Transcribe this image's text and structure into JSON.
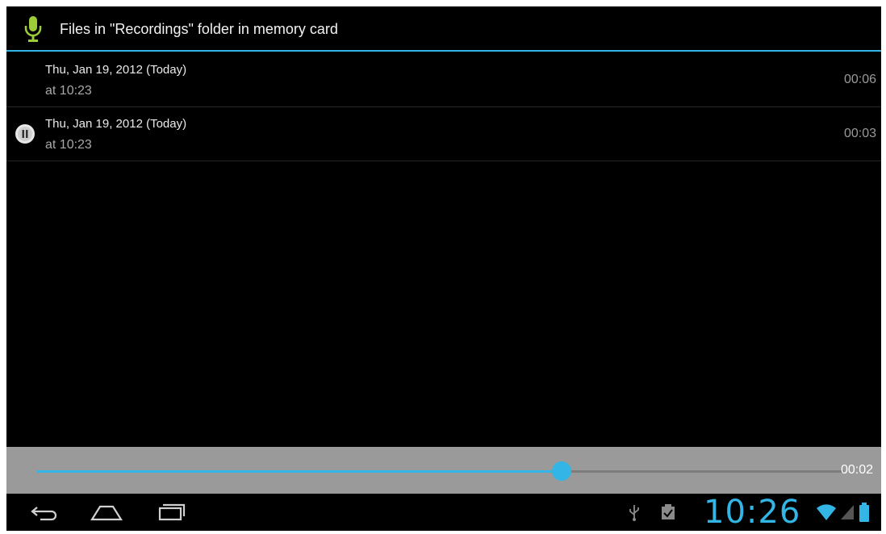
{
  "action_bar": {
    "title": "Files in \"Recordings\" folder in memory card",
    "icon": "microphone-icon",
    "accent_color": "#33b5e5"
  },
  "recordings": [
    {
      "date": "Thu, Jan 19, 2012 (Today)",
      "time": "at 10:23",
      "duration": "00:06",
      "playing": false
    },
    {
      "date": "Thu, Jan 19, 2012 (Today)",
      "time": "at 10:23",
      "duration": "00:03",
      "playing": true
    }
  ],
  "player": {
    "elapsed": "00:02",
    "progress_fraction": 0.65
  },
  "system_bar": {
    "clock": "10:26",
    "nav_icons": [
      "back-icon",
      "home-icon",
      "recent-apps-icon"
    ],
    "status_icons": [
      "usb-icon",
      "clipboard-check-icon",
      "wifi-icon",
      "signal-icon",
      "battery-icon"
    ]
  }
}
